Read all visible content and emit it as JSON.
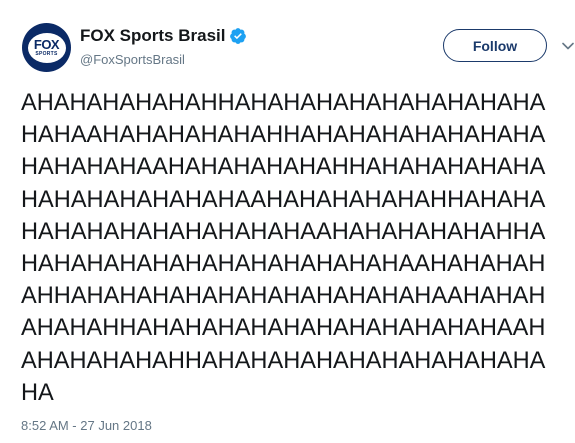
{
  "author": {
    "display_name": "FOX Sports Brasil",
    "handle": "@FoxSportsBrasil",
    "verified": true,
    "verified_icon": "verified-badge-icon",
    "verified_color": "#1da1f2",
    "avatar_logo_text": "FOX",
    "avatar_logo_subtext": "SPORTS",
    "avatar_color": "#0b2a66"
  },
  "actions": {
    "follow_label": "Follow",
    "more_icon": "chevron-down-icon"
  },
  "tweet": {
    "lines": [
      "AHAHAHAHAHAHHAHAHAHAHAHAHAHAHAHA",
      "HAHAAHAHAHAHAHAHHAHAHAHAHAHAHAHA",
      "HAHAHAHAAHAHAHAHAHAHHAHAHAHAHAHA",
      "HAHAHAHAHAHAHAAHAHAHAHAHAHHAHAHA",
      "HAHAHAHAHAHAHAHAHAAHAHAHAHAHAHHA",
      "HAHAHAHAHAHAHAHAHAHAHAHAAHAHAHAH",
      "AHHAHAHAHAHAHAHAHAHAHAHAHAAHAHAH",
      "AHAHAHHAHAHAHAHAHAHAHAHAHAHAHAAH",
      "AHAHAHAHAHHAHAHAHAHAHAHAHAHAHAHA",
      "HA"
    ],
    "timestamp": "8:52 AM - 27 Jun 2018"
  }
}
